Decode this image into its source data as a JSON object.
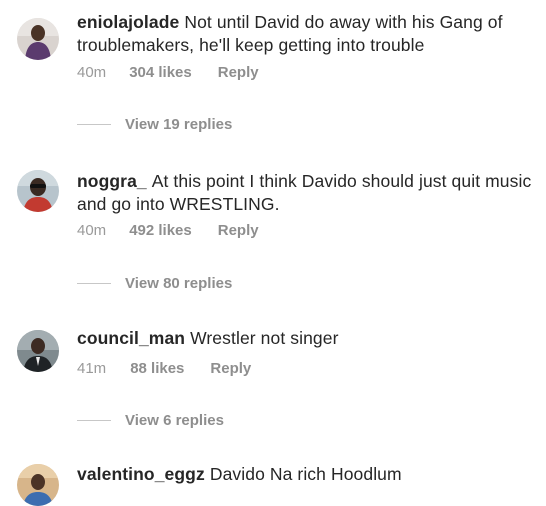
{
  "comments": [
    {
      "username": "eniolajolade",
      "text": "Not until David do away with his Gang of troublemakers, he'll keep getting into trouble",
      "time": "40m",
      "likes": "304 likes",
      "reply": "Reply",
      "view_replies": "View 19 replies"
    },
    {
      "username": "noggra_",
      "text": "At this point I think Davido should just quit music and go into WRESTLING.",
      "time": "40m",
      "likes": "492 likes",
      "reply": "Reply",
      "view_replies": "View 80 replies"
    },
    {
      "username": "council_man",
      "text": "Wrestler not singer",
      "time": "41m",
      "likes": "88 likes",
      "reply": "Reply",
      "view_replies": "View 6 replies"
    },
    {
      "username": "valentino_eggz",
      "text": "Davido Na rich Hoodlum"
    }
  ]
}
